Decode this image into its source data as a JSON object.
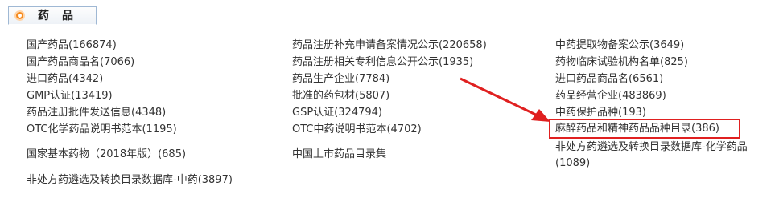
{
  "tab": {
    "title": "药品",
    "icon": "orange-bullet-icon"
  },
  "columns": [
    [
      "国产药品(166874)",
      "国产药品商品名(7066)",
      "进口药品(4342)",
      "GMP认证(13419)",
      "药品注册批件发送信息(4348)",
      "OTC化学药品说明书范本(1195)",
      "国家基本药物（2018年版）(685)",
      "非处方药遴选及转换目录数据库-中药(3897)"
    ],
    [
      "药品注册补充申请备案情况公示(220658)",
      "药品注册相关专利信息公开公示(1935)",
      "药品生产企业(7784)",
      "批准的药包材(5807)",
      "GSP认证(324794)",
      "OTC中药说明书范本(4702)",
      "中国上市药品目录集"
    ],
    [
      "中药提取物备案公示(3649)",
      "药物临床试验机构名单(825)",
      "进口药品商品名(6561)",
      "药品经营企业(483869)",
      "中药保护品种(193)",
      "麻醉药品和精神药品品种目录(386)",
      "非处方药遴选及转换目录数据库-化学药品",
      "(1089)"
    ]
  ],
  "annotation": {
    "color": "#e02020"
  },
  "colors": {
    "link": "#333333",
    "tab_border": "#9fb8d4",
    "bullet": "#f58a1f"
  }
}
